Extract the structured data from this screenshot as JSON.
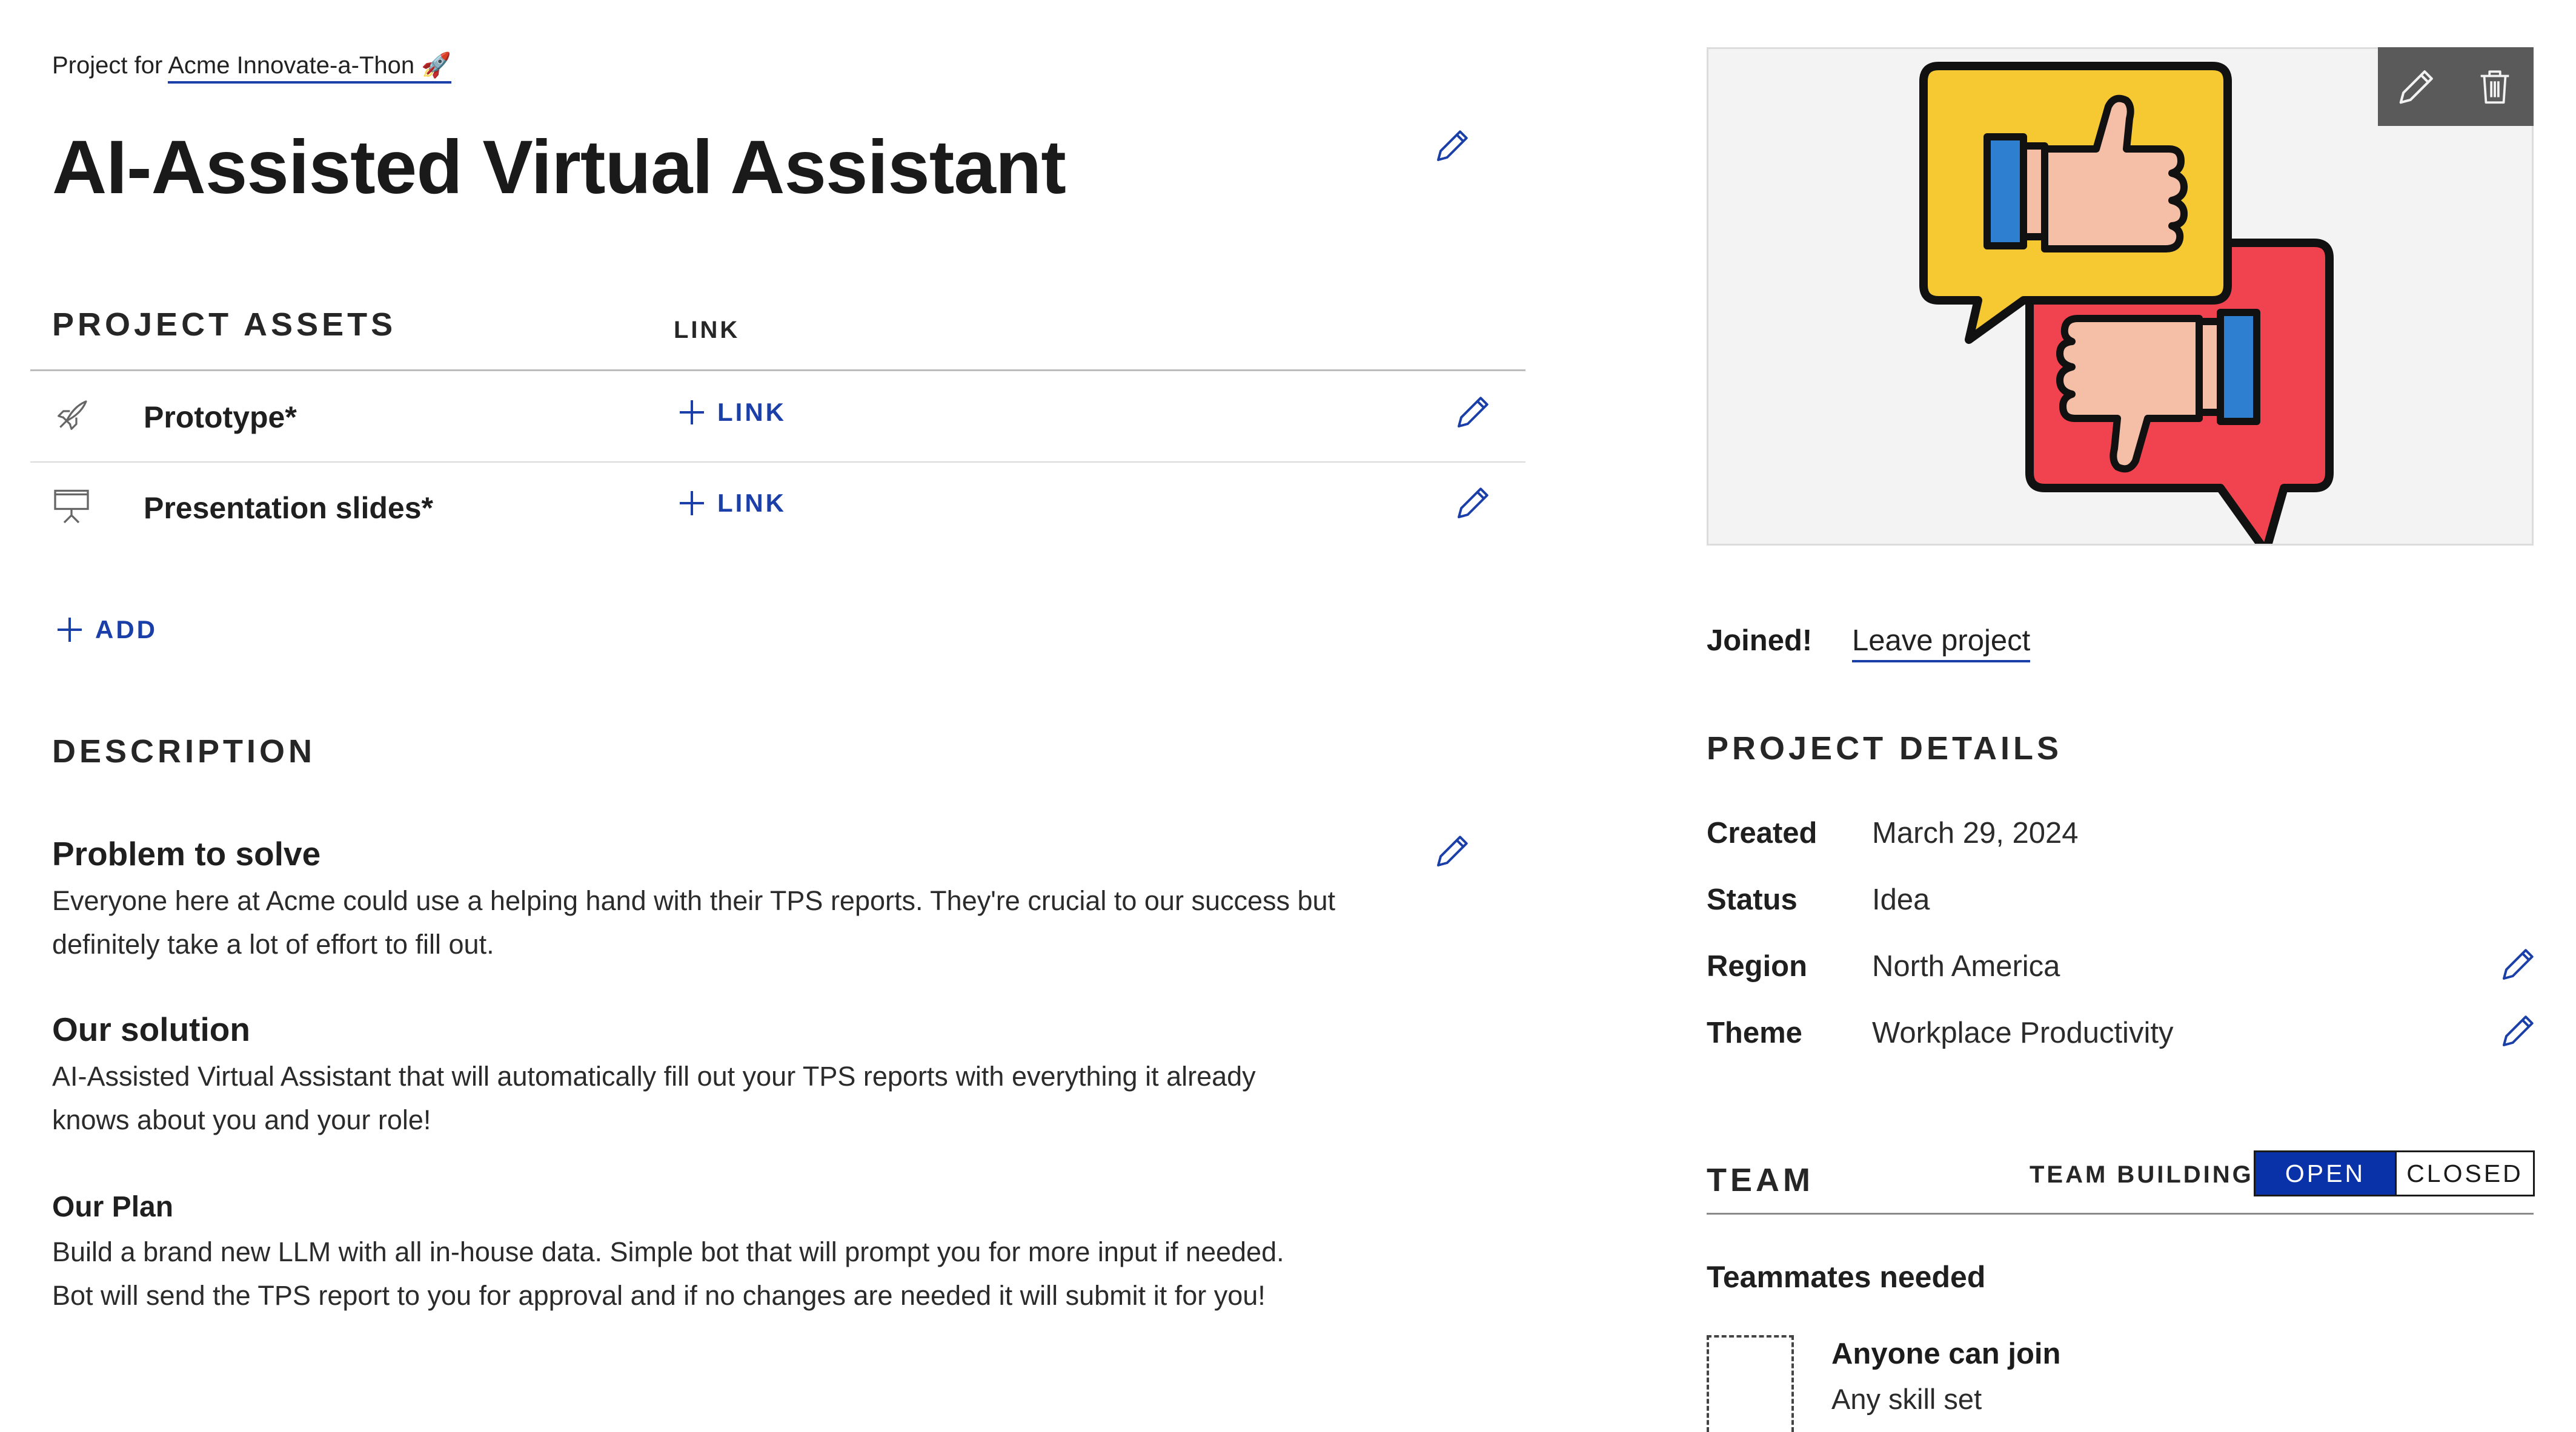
{
  "breadcrumb": {
    "prefix": "Project for",
    "hackathon": "Acme Innovate-a-Thon 🚀"
  },
  "project": {
    "title": "AI-Assisted Virtual Assistant"
  },
  "assets": {
    "heading": "PROJECT ASSETS",
    "link_heading": "LINK",
    "items": [
      {
        "icon": "rocket-icon",
        "label": "Prototype*",
        "link_label": "LINK"
      },
      {
        "icon": "presentation-icon",
        "label": "Presentation slides*",
        "link_label": "LINK"
      }
    ],
    "add_label": "ADD"
  },
  "description": {
    "heading": "DESCRIPTION",
    "sections": [
      {
        "title": "Problem to solve",
        "lines": [
          "Everyone here at Acme could use a helping hand with their TPS reports. They're crucial to our success but",
          "definitely take a lot of effort to fill out."
        ]
      },
      {
        "title": "Our solution",
        "lines": [
          "AI-Assisted Virtual Assistant that will automatically fill out your TPS reports with everything it already",
          "knows about you and your role!"
        ]
      },
      {
        "title": "Our Plan",
        "lines": [
          "Build a brand new LLM with all in-house data. Simple bot that will prompt you for more input if needed.",
          "Bot will send the TPS report to you for approval and if no changes are needed it will submit it for you!"
        ]
      }
    ]
  },
  "membership": {
    "status": "Joined!",
    "leave_label": "Leave project"
  },
  "details": {
    "heading": "PROJECT DETAILS",
    "rows": [
      {
        "label": "Created",
        "value": "March 29, 2024",
        "editable": false
      },
      {
        "label": "Status",
        "value": "Idea",
        "editable": false
      },
      {
        "label": "Region",
        "value": "North America",
        "editable": true
      },
      {
        "label": "Theme",
        "value": "Workplace Productivity",
        "editable": true
      }
    ]
  },
  "team": {
    "heading": "TEAM",
    "building_label": "TEAM BUILDING",
    "toggle": {
      "open": "OPEN",
      "closed": "CLOSED",
      "selected": "OPEN"
    },
    "needed_heading": "Teammates needed",
    "slot": {
      "title": "Anyone can join",
      "subtitle": "Any skill set"
    }
  },
  "colors": {
    "accent": "#1a3fa8",
    "toggle_active": "#0a32a8",
    "thumbs_up_bubble": "#f6c933",
    "thumbs_down_bubble": "#f1434f",
    "cuff_blue": "#2e7fd0",
    "skin": "#f4bfa6"
  },
  "image": {
    "subject": "thumbs-up and thumbs-down speech bubbles"
  }
}
